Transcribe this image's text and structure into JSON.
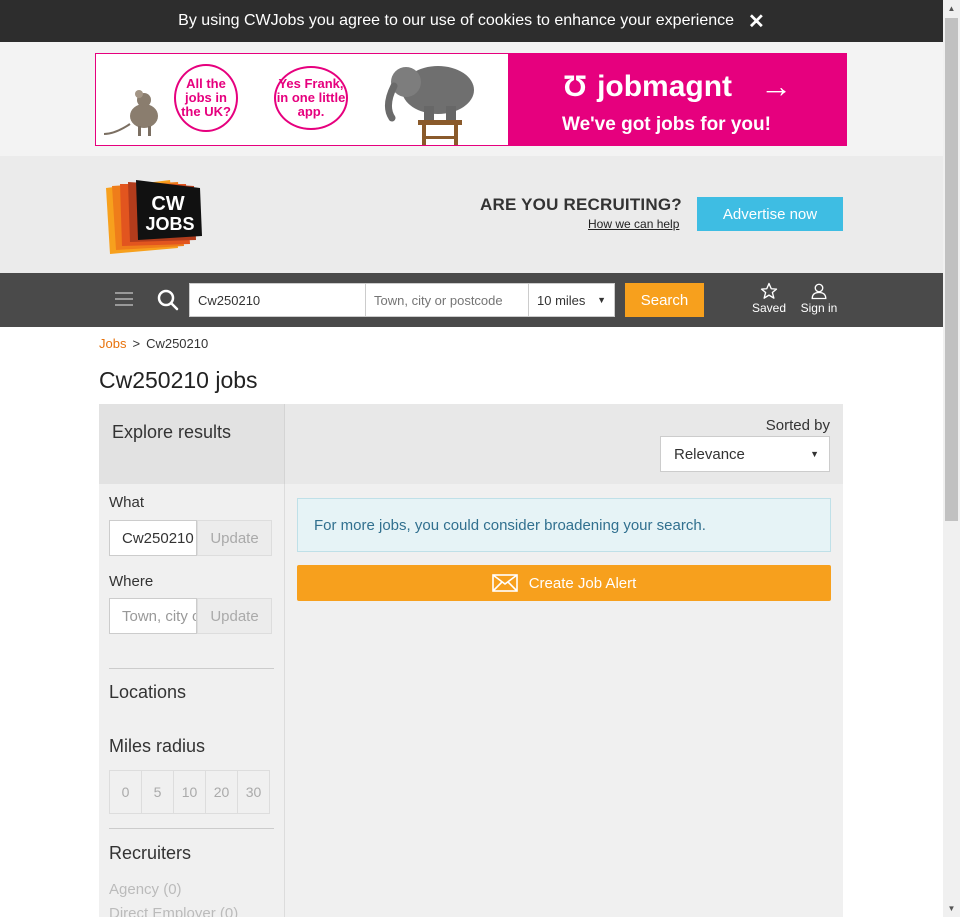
{
  "cookie_bar": {
    "text": "By using CWJobs you agree to our use of cookies to enhance your experience",
    "close": "✕"
  },
  "ad": {
    "bubble1": "All the jobs in the UK?",
    "bubble2": "Yes Frank, in one little app.",
    "brand": "jobmagnt",
    "tagline": "We've got jobs for you!",
    "brand_color": "#e6007e"
  },
  "header": {
    "logo_text_1": "CW",
    "logo_text_2": "JOBS",
    "recruiting_title": "ARE YOU RECRUITING?",
    "recruiting_link": "How we can help",
    "advertise_label": "Advertise now"
  },
  "search": {
    "keyword_value": "Cw250210",
    "location_placeholder": "Town, city or postcode",
    "miles_value": "10 miles",
    "button_label": "Search",
    "saved_label": "Saved",
    "signin_label": "Sign in"
  },
  "breadcrumb": {
    "home": "Jobs",
    "separator": ">",
    "current": "Cw250210"
  },
  "page_title": "Cw250210 jobs",
  "results": {
    "explore_title": "Explore results",
    "sorted_by_label": "Sorted by",
    "sort_value": "Relevance",
    "notice": "For more jobs, you could consider broadening your search.",
    "alert_label": "Create Job Alert"
  },
  "sidebar": {
    "what_label": "What",
    "what_value": "Cw250210",
    "where_label": "Where",
    "where_placeholder": "Town, city or postcode",
    "update_label": "Update",
    "locations_heading": "Locations",
    "miles_heading": "Miles radius",
    "miles_options": [
      "0",
      "5",
      "10",
      "20",
      "30"
    ],
    "recruiters_heading": "Recruiters",
    "recruiters": [
      "Agency (0)",
      "Direct Employer (0)"
    ]
  },
  "colors": {
    "accent_orange": "#f7a01d",
    "advertise_blue": "#3ebde3",
    "link_orange": "#e8730c"
  }
}
